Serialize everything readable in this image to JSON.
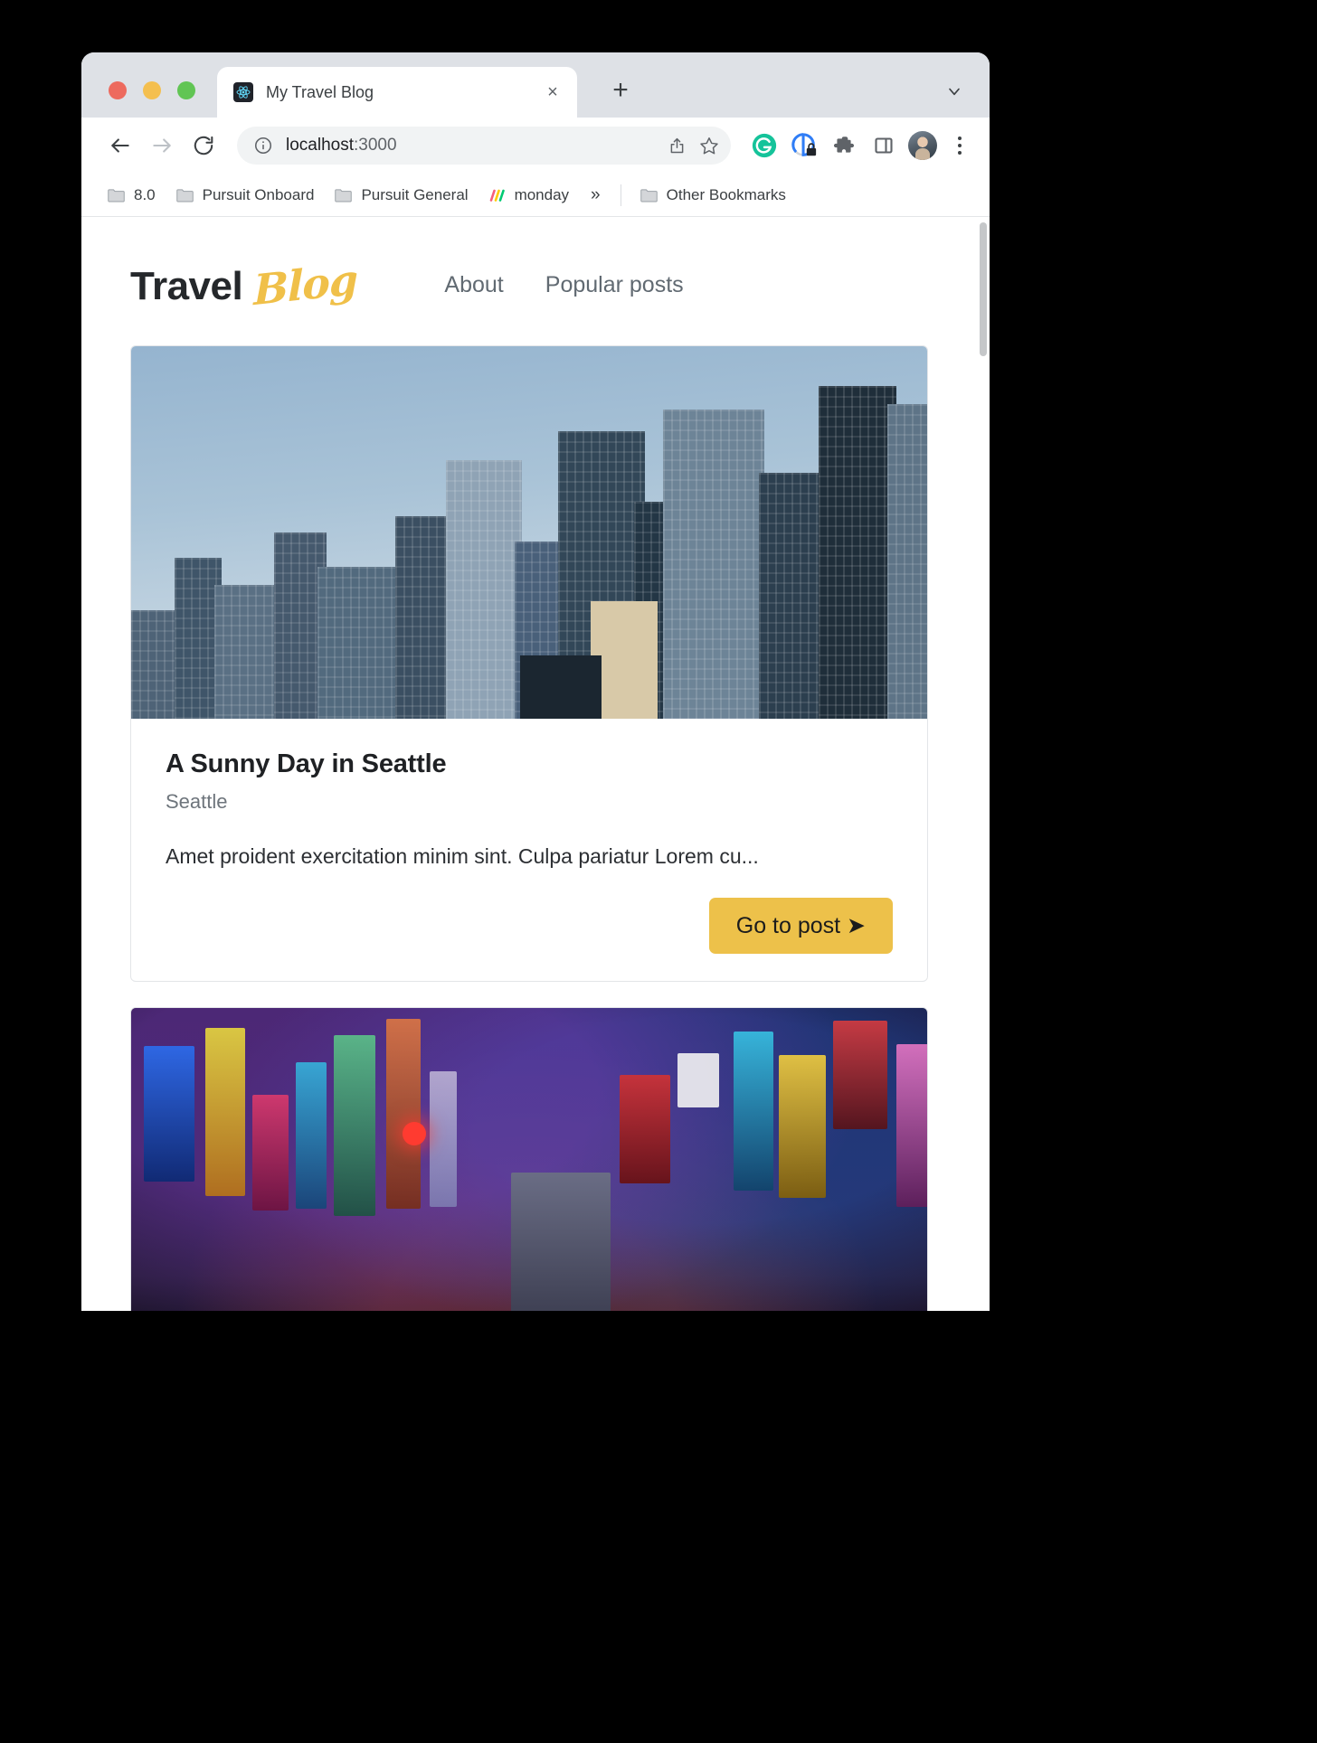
{
  "browser": {
    "tab": {
      "title": "My Travel Blog",
      "favicon": "react-logo-icon",
      "close": "×"
    },
    "new_tab_label": "+",
    "tab_list_label": "⌄",
    "nav": {
      "back": "←",
      "forward": "→",
      "reload": "⟳"
    },
    "omnibox": {
      "info_icon": "info-circle-icon",
      "url_host": "localhost",
      "url_port": ":3000",
      "share_icon": "share-icon",
      "bookmark_icon": "star-icon"
    },
    "extensions": [
      {
        "name": "grammarly-extension-icon",
        "color": "#15c39a"
      },
      {
        "name": "privacy-badger-extension-icon",
        "color": "#2f7df6"
      },
      {
        "name": "extensions-puzzle-icon",
        "color": "#5f6368"
      },
      {
        "name": "side-panel-icon",
        "color": "#5f6368"
      }
    ],
    "profile_label": "profile-avatar",
    "menu_label": "⋮",
    "bookmarks": [
      {
        "label": "8.0",
        "icon": "folder-icon"
      },
      {
        "label": "Pursuit Onboard",
        "icon": "folder-icon"
      },
      {
        "label": "Pursuit General",
        "icon": "folder-icon"
      },
      {
        "label": "monday",
        "icon": "monday-icon"
      }
    ],
    "bookmarks_overflow": "»",
    "other_bookmarks": {
      "label": "Other Bookmarks",
      "icon": "folder-icon"
    }
  },
  "site": {
    "logo": {
      "primary": "Travel",
      "script": "Blog"
    },
    "nav": [
      {
        "label": "About"
      },
      {
        "label": "Popular posts"
      }
    ],
    "accent_color": "#edc14a"
  },
  "posts": [
    {
      "image_alt": "seattle-skyline-photo",
      "title": "A Sunny Day in Seattle",
      "location": "Seattle",
      "excerpt": "Amet proident exercitation minim sint. Culpa pariatur Lorem cu...",
      "cta": "Go to post ➤"
    },
    {
      "image_alt": "tokyo-neon-street-photo"
    }
  ]
}
